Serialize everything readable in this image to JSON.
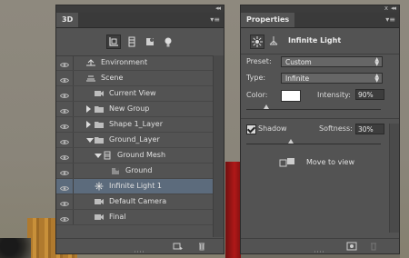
{
  "panel3d": {
    "tab": "3D",
    "layers": [
      {
        "label": "Environment",
        "icon": "environment-icon",
        "depth": 0,
        "expander": "none",
        "selected": false
      },
      {
        "label": "Scene",
        "icon": "scene-icon",
        "depth": 0,
        "expander": "none",
        "selected": false
      },
      {
        "label": "Current View",
        "icon": "camera-icon",
        "depth": 1,
        "expander": "none",
        "selected": false
      },
      {
        "label": "New Group",
        "icon": "folder-icon",
        "depth": 1,
        "expander": "right",
        "selected": false
      },
      {
        "label": "Shape 1_Layer",
        "icon": "folder-icon",
        "depth": 1,
        "expander": "right",
        "selected": false
      },
      {
        "label": "Ground_Layer",
        "icon": "folder-icon",
        "depth": 1,
        "expander": "down",
        "selected": false
      },
      {
        "label": "Ground Mesh",
        "icon": "mesh-icon",
        "depth": 2,
        "expander": "down",
        "selected": false
      },
      {
        "label": "Ground",
        "icon": "material-icon",
        "depth": 3,
        "expander": "none",
        "selected": false
      },
      {
        "label": "Infinite Light 1",
        "icon": "infinite-light-icon",
        "depth": 1,
        "expander": "none",
        "selected": true
      },
      {
        "label": "Default Camera",
        "icon": "camera-icon",
        "depth": 1,
        "expander": "none",
        "selected": false
      },
      {
        "label": "Final",
        "icon": "camera-icon",
        "depth": 1,
        "expander": "none",
        "selected": false
      }
    ]
  },
  "properties": {
    "tab": "Properties",
    "title": "Infinite Light",
    "preset_label": "Preset:",
    "preset_value": "Custom",
    "type_label": "Type:",
    "type_value": "Infinite",
    "color_label": "Color:",
    "color_value": "#ffffff",
    "intensity_label": "Intensity:",
    "intensity_value": "90%",
    "shadow_label": "Shadow",
    "shadow_checked": true,
    "softness_label": "Softness:",
    "softness_value": "30%",
    "move_to_view": "Move to view"
  }
}
